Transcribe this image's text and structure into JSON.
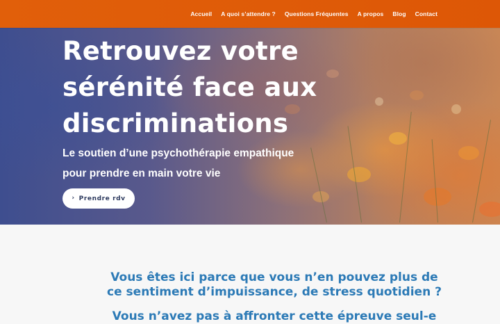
{
  "nav": {
    "items": [
      {
        "label": "Accueil"
      },
      {
        "label": "A quoi s’attendre ?"
      },
      {
        "label": "Questions Fréquentes"
      },
      {
        "label": "A propos"
      },
      {
        "label": "Blog"
      },
      {
        "label": "Contact"
      }
    ]
  },
  "hero": {
    "title": "Retrouvez votre sérénité face aux discriminations",
    "subtitle": "Le soutien d’une psychothérapie empathique pour prendre en main votre vie",
    "cta_label": "Prendre rdv",
    "cta_icon": "chevron-right-icon"
  },
  "intro": {
    "question": "Vous êtes ici parce que vous n’en pouvez plus de ce sentiment d’impuissance, de stress quotidien ?",
    "statement": "Vous n’avez pas à affronter cette épreuve seul-e"
  },
  "colors": {
    "header_bg": "#e15f0a",
    "accent_text": "#2c7ab6",
    "cta_text": "#2d3a5e",
    "page_bg": "#f7f7f7"
  }
}
